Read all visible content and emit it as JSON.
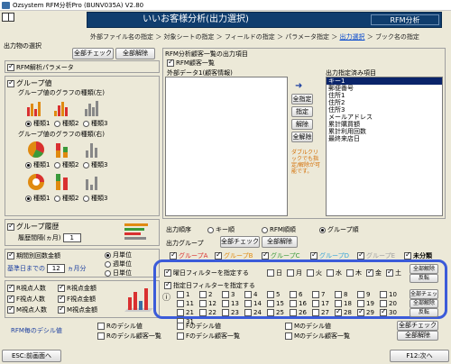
{
  "window": {
    "title": "Ozsystem RFM分析Pro (BUNV035A)   V2.80"
  },
  "banner": {
    "title": "いいお客様分析(出力選択)",
    "badge": "RFM分析"
  },
  "breadcrumb": [
    "外部ファイル名の指定",
    "対象シートの指定",
    "フィールドの指定",
    "パラメータ指定",
    "出力選択",
    "ブック名の指定"
  ],
  "left": {
    "heading": "出力物の選択",
    "check_all": "全部チェック",
    "uncheck_all": "全部解除",
    "rfm_param": "RFM解析パラメータ",
    "group_value": "グループ値",
    "graph_kind_left": "グループ値のグラフの種類(左)",
    "graph_kind_right": "グループ値のグラフの種類(右)",
    "kinds": [
      "種類1",
      "種類2",
      "種類3"
    ],
    "group_history": "グループ履歴",
    "history_period": "履歴間隔(ヵ月)",
    "history_value": "1",
    "period_count": "期間別回数金額",
    "base_date": "基準日までの",
    "base_value": "12",
    "month_unit": "ヵ月分",
    "units": [
      "月単位",
      "週単位",
      "日単位"
    ],
    "persons": [
      "R視点人数",
      "F視点人数",
      "M視点人数"
    ],
    "amounts": [
      "R視点金額",
      "F視点金額",
      "M視点金額"
    ]
  },
  "right": {
    "heading": "RFM分析顧客一覧の出力項目",
    "customer_list": "RFM顧客一覧",
    "external_data": "外部データ1(顧客情報)",
    "output_heading": "出力指定済み項目",
    "output_items": [
      "キー1",
      "郵便番号",
      "住所1",
      "住所2",
      "住所3",
      "メールアドレス",
      "累計購買額",
      "累計利用回数",
      "最終来店日"
    ],
    "buttons": [
      "全指定",
      "指定",
      "解除",
      "全解除"
    ],
    "hint": "ダブルクリックでも指定/解除が可能です。",
    "order_label": "出力順序",
    "orders": [
      "キー順",
      "RFM順順",
      "グループ順"
    ],
    "group_label": "出力グループ",
    "groups": [
      "グループA",
      "グループB",
      "グループC",
      "グループD",
      "グループE",
      "未分類"
    ],
    "group_colors": [
      "#d93030",
      "#e08a10",
      "#3a9a3a",
      "#3aa6d9",
      "#a0a0a0",
      "#000000"
    ]
  },
  "filter": {
    "weekday_label": "曜日フィルターを指定する",
    "weekdays": [
      "日",
      "月",
      "火",
      "水",
      "木",
      "金",
      "土"
    ],
    "date_label": "指定日フィルターを指定する",
    "days": [
      "1",
      "2",
      "3",
      "4",
      "5",
      "6",
      "7",
      "8",
      "9",
      "10",
      "11",
      "12",
      "13",
      "14",
      "15",
      "16",
      "17",
      "18",
      "19",
      "20",
      "21",
      "22",
      "23",
      "24",
      "25",
      "26",
      "27",
      "28",
      "29",
      "30",
      "31"
    ],
    "check_all": "全部チェック",
    "uncheck_all": "全部解除",
    "invert": "反転"
  },
  "decimal": {
    "label": "RFM毎のデシル値",
    "items": [
      "Rのデシル値",
      "Fのデシル値",
      "Mのデシル値",
      "Rのデシル顧客一覧",
      "Fのデシル顧客一覧",
      "Mのデシル顧客一覧"
    ]
  },
  "footer": {
    "back": "ESC:前画面へ",
    "next": "F12:次へ"
  }
}
